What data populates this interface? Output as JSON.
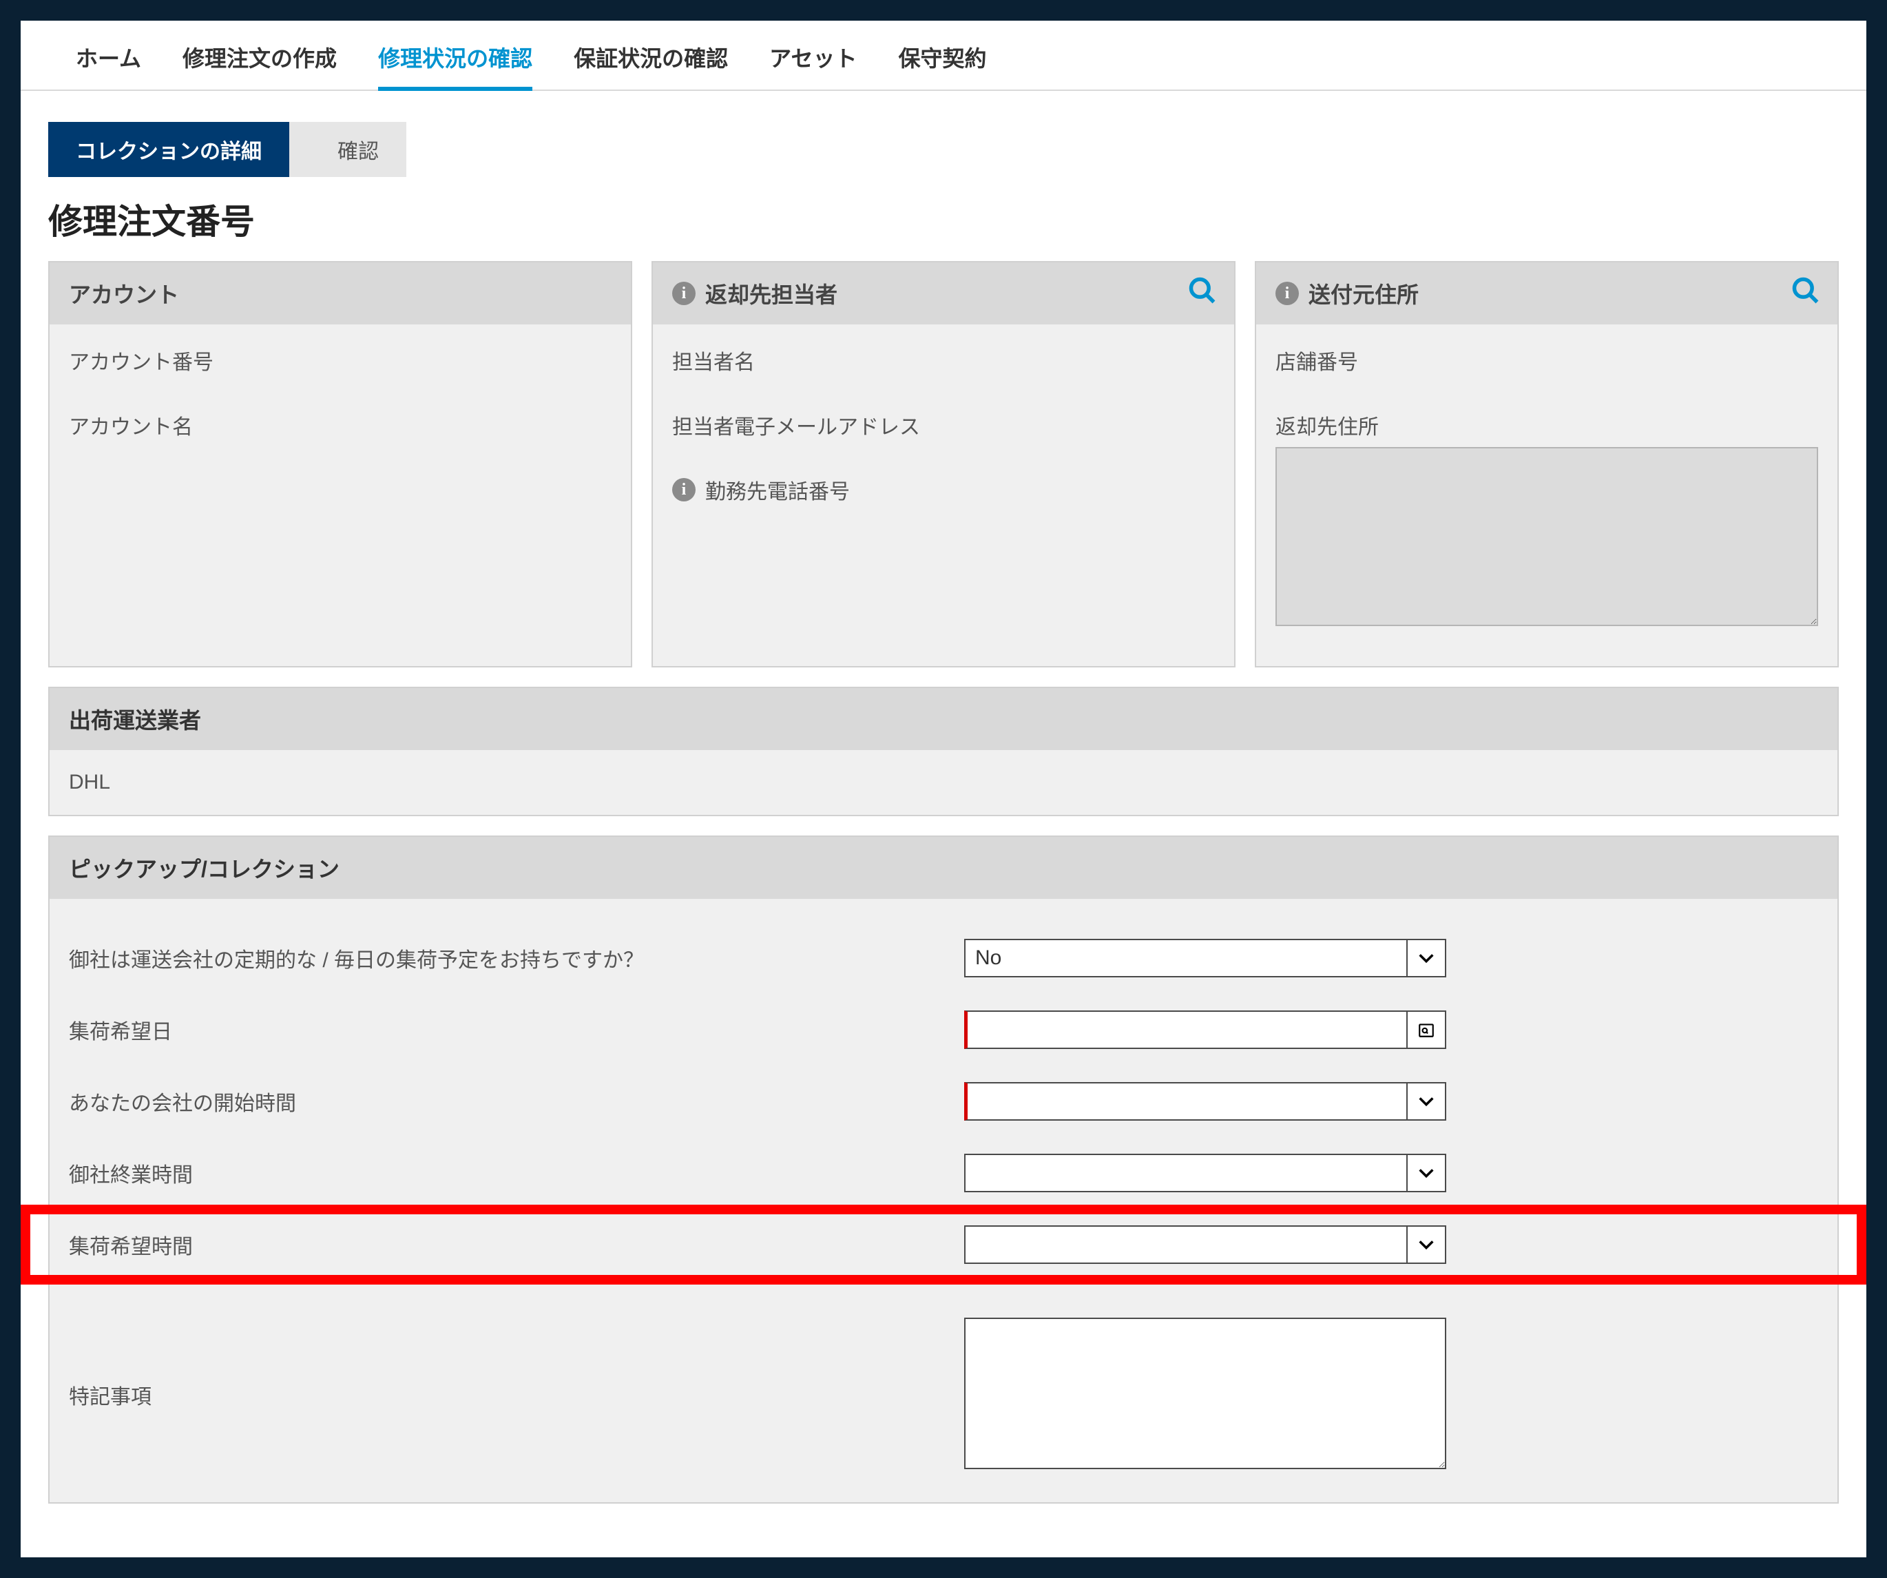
{
  "nav": {
    "items": [
      {
        "label": "ホーム",
        "active": false
      },
      {
        "label": "修理注文の作成",
        "active": false
      },
      {
        "label": "修理状況の確認",
        "active": true
      },
      {
        "label": "保証状況の確認",
        "active": false
      },
      {
        "label": "アセット",
        "active": false
      },
      {
        "label": "保守契約",
        "active": false
      }
    ]
  },
  "wizard": {
    "current": "コレクションの詳細",
    "next": "確認"
  },
  "page_title": "修理注文番号",
  "panels": {
    "account": {
      "title": "アカウント",
      "fields": {
        "number_label": "アカウント番号",
        "name_label": "アカウント名"
      }
    },
    "return_contact": {
      "title": "返却先担当者",
      "fields": {
        "name_label": "担当者名",
        "email_label": "担当者電子メールアドレス",
        "phone_label": "勤務先電話番号"
      }
    },
    "ship_from": {
      "title": "送付元住所",
      "fields": {
        "store_no_label": "店舗番号",
        "return_addr_label": "返却先住所"
      }
    }
  },
  "carrier": {
    "title": "出荷運送業者",
    "value": "DHL"
  },
  "pickup": {
    "title": "ピックアップ/コレクション",
    "q_schedule_label": "御社は運送会社の定期的な / 毎日の集荷予定をお持ちですか？",
    "q_schedule_value": "No",
    "date_label": "集荷希望日",
    "date_value": "",
    "open_label": "あなたの会社の開始時間",
    "open_value": "",
    "close_label": "御社終業時間",
    "close_value": "",
    "pref_time_label": "集荷希望時間",
    "pref_time_value": "",
    "notes_label": "特記事項",
    "notes_value": ""
  },
  "colors": {
    "accent": "#0093d0",
    "brand_dark": "#003a70",
    "highlight": "#ff0000"
  }
}
